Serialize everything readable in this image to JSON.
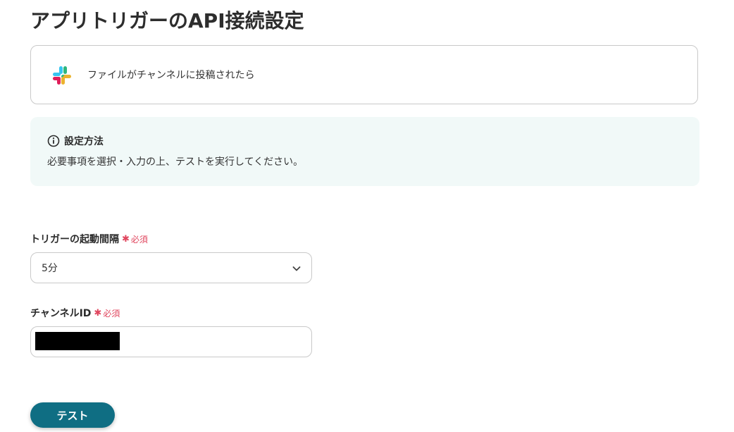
{
  "page": {
    "title": "アプリトリガーのAPI接続設定"
  },
  "trigger": {
    "app_icon": "slack-icon",
    "label": "ファイルがチャンネルに投稿されたら"
  },
  "info": {
    "icon": "info-icon",
    "heading": "設定方法",
    "body": "必要事項を選択・入力の上、テストを実行してください。"
  },
  "fields": {
    "interval": {
      "label": "トリガーの起動間隔",
      "required_mark": "✱",
      "required_text": "必須",
      "value": "5分"
    },
    "channel_id": {
      "label": "チャンネルID",
      "required_mark": "✱",
      "required_text": "必須",
      "value": ""
    }
  },
  "actions": {
    "test_label": "テスト"
  },
  "colors": {
    "primary": "#0f6e83",
    "required": "#e0465e",
    "info_bg": "#f1f9f8",
    "border": "#c9c9c9"
  }
}
